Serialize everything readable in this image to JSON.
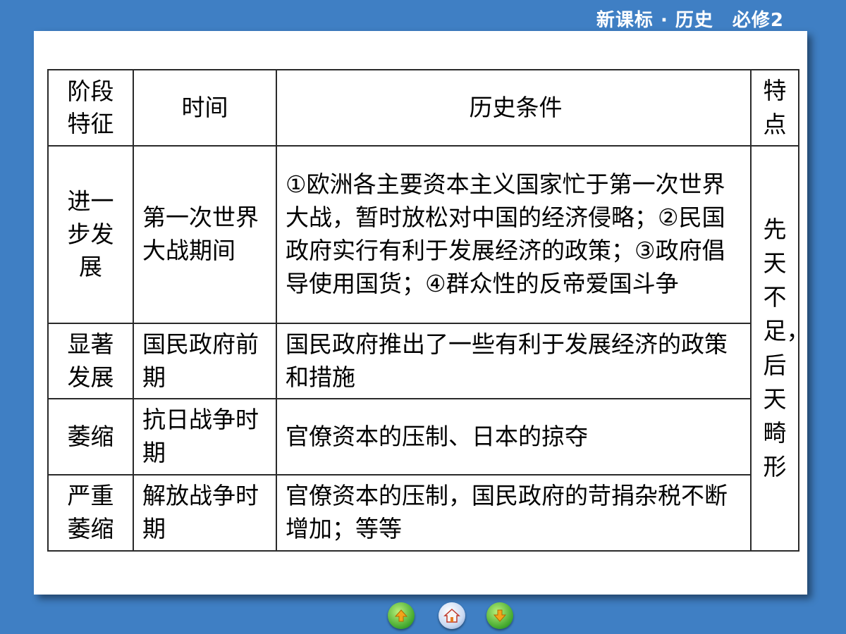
{
  "header": {
    "title": "新课标 · 历史　必修2"
  },
  "table": {
    "headers": [
      "阶段特征",
      "时间",
      "历史条件",
      "特点"
    ],
    "rows": [
      {
        "stage": "进一步发展",
        "time": "第一次世界大战期间",
        "conditions": "①欧洲各主要资本主义国家忙于第一次世界大战，暂时放松对中国的经济侵略；②民国政府实行有利于发展经济的政策；③政府倡导使用国货；④群众性的反帝爱国斗争"
      },
      {
        "stage": "显著发展",
        "time": "国民政府前期",
        "conditions": "国民政府推出了一些有利于发展经济的政策和措施"
      },
      {
        "stage": "萎缩",
        "time": "抗日战争时期",
        "conditions": "官僚资本的压制、日本的掠夺"
      },
      {
        "stage": "严重萎缩",
        "time": "解放战争时期",
        "conditions": "官僚资本的压制，国民政府的苛捐杂税不断增加；等等"
      }
    ],
    "feature": "先天不足，后天畸形"
  },
  "nav": {
    "prev_icon": "up-arrow-icon",
    "home_icon": "home-icon",
    "next_icon": "down-arrow-icon"
  }
}
